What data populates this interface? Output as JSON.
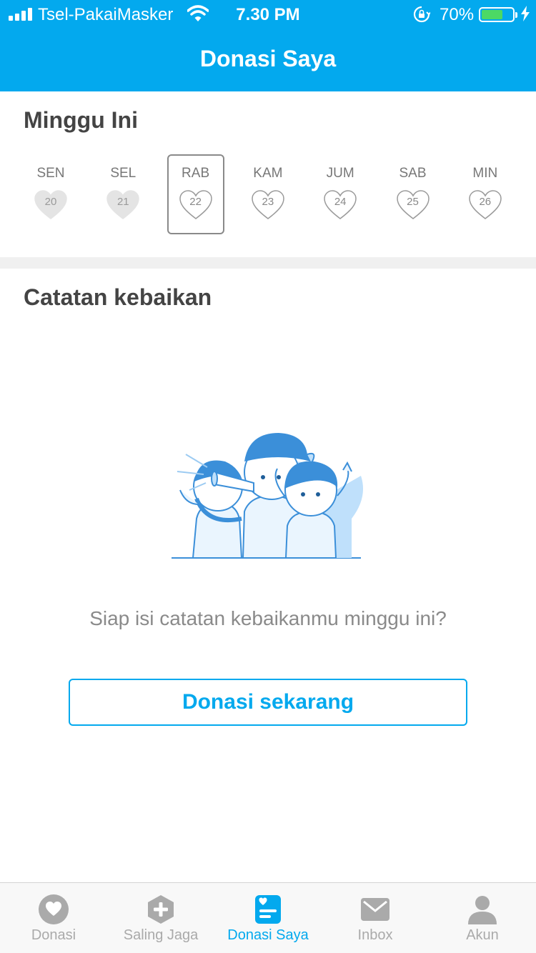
{
  "status_bar": {
    "carrier": "Tsel-PakaiMasker",
    "time": "7.30 PM",
    "battery_pct": "70%",
    "battery_level": 0.7,
    "icons": [
      "signal-icon",
      "wifi-icon",
      "rotation-lock-icon",
      "battery-icon",
      "charging-bolt-icon"
    ]
  },
  "header": {
    "title": "Donasi Saya"
  },
  "week": {
    "title": "Minggu Ini",
    "days": [
      {
        "label": "SEN",
        "date": "20",
        "state": "past"
      },
      {
        "label": "SEL",
        "date": "21",
        "state": "past"
      },
      {
        "label": "RAB",
        "date": "22",
        "state": "today"
      },
      {
        "label": "KAM",
        "date": "23",
        "state": "future"
      },
      {
        "label": "JUM",
        "date": "24",
        "state": "future"
      },
      {
        "label": "SAB",
        "date": "25",
        "state": "future"
      },
      {
        "label": "MIN",
        "date": "26",
        "state": "future"
      }
    ]
  },
  "notes": {
    "title": "Catatan kebaikan",
    "empty_text": "Siap isi catatan kebaikanmu minggu ini?",
    "cta_label": "Donasi sekarang"
  },
  "tabs": [
    {
      "label": "Donasi",
      "icon": "heart-circle-icon",
      "active": false
    },
    {
      "label": "Saling Jaga",
      "icon": "plus-hexagon-icon",
      "active": false
    },
    {
      "label": "Donasi Saya",
      "icon": "donation-note-icon",
      "active": true
    },
    {
      "label": "Inbox",
      "icon": "envelope-icon",
      "active": false
    },
    {
      "label": "Akun",
      "icon": "person-icon",
      "active": false
    }
  ],
  "colors": {
    "primary": "#03a9ee",
    "tab_inactive": "#aaaaaa",
    "battery_green": "#4cd964"
  }
}
